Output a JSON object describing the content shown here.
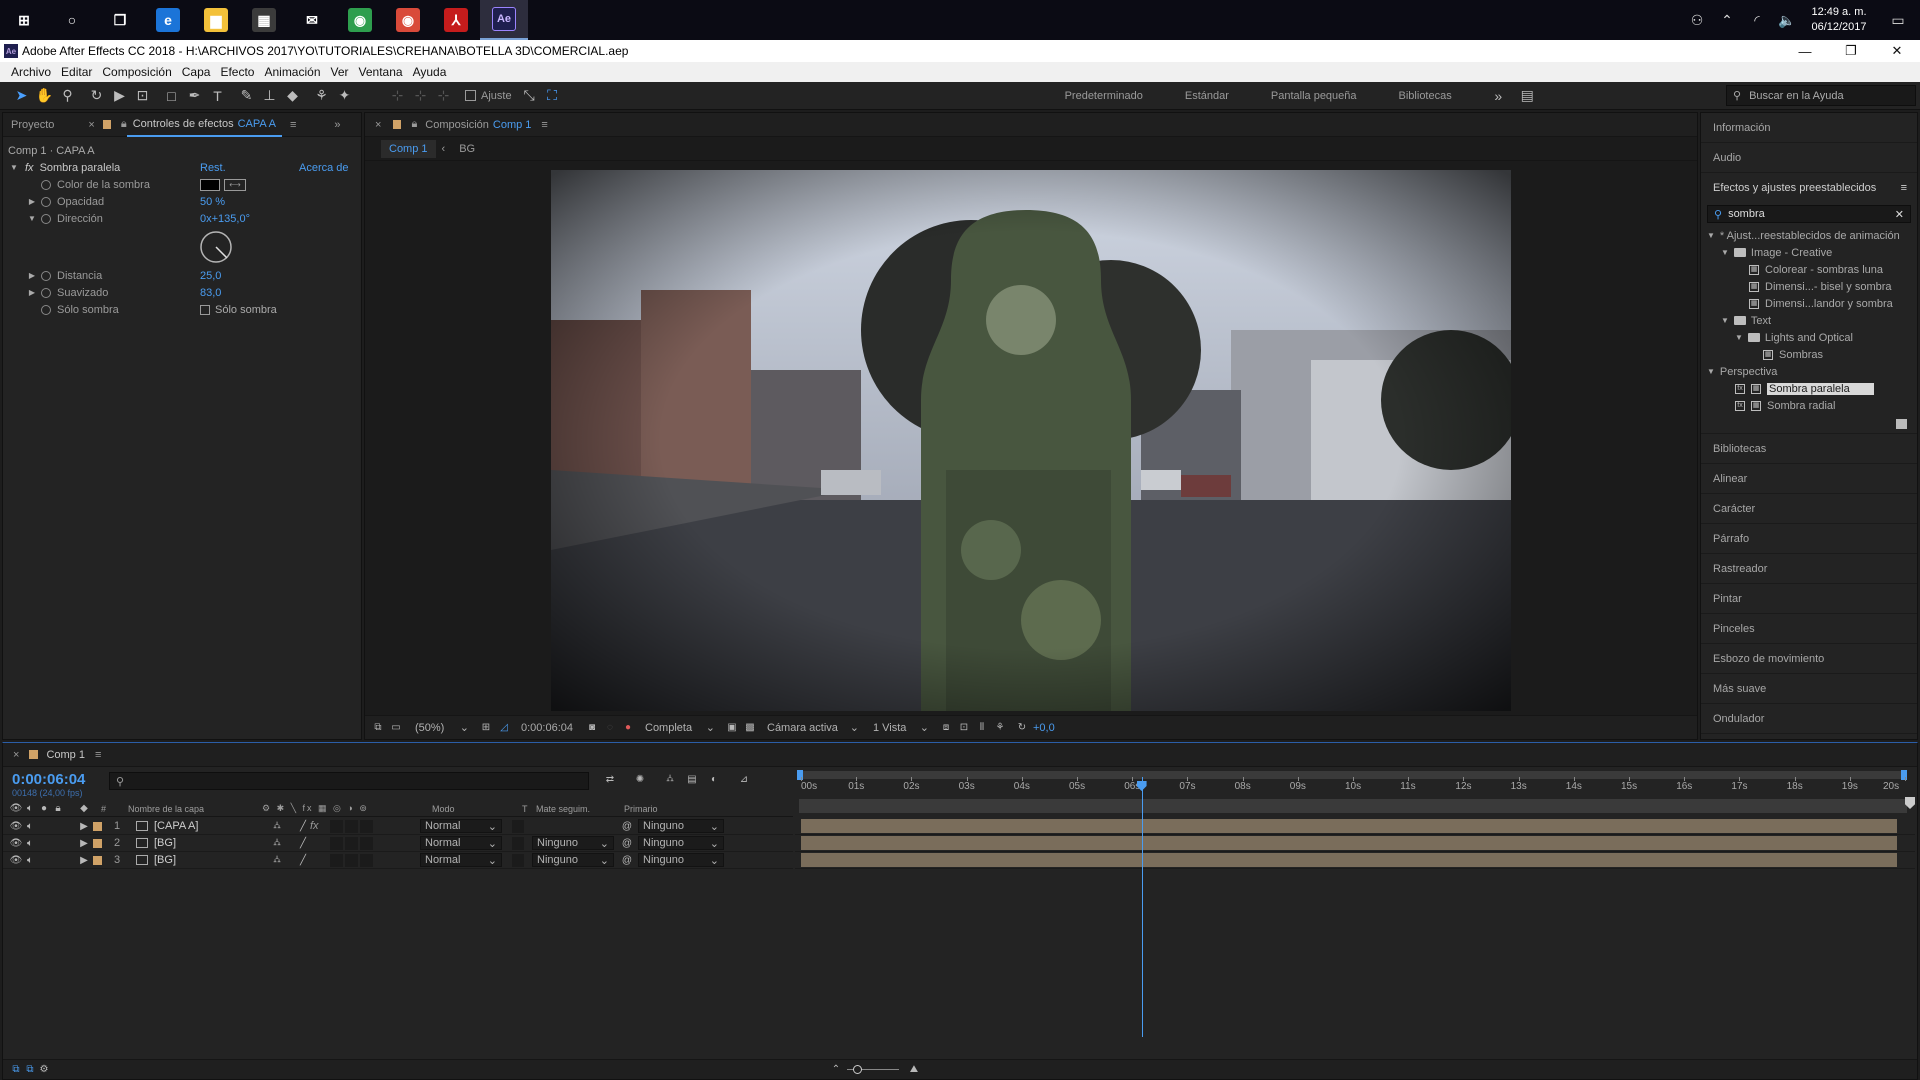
{
  "taskbar": {
    "apps": [
      {
        "name": "start-icon",
        "glyph": "⊞",
        "bg": "transparent"
      },
      {
        "name": "cortana-icon",
        "glyph": "○",
        "bg": "transparent"
      },
      {
        "name": "task-view-icon",
        "glyph": "❐",
        "bg": "transparent"
      },
      {
        "name": "edge-icon",
        "glyph": "e",
        "bg": "#1b74d8"
      },
      {
        "name": "file-explorer-icon",
        "glyph": "▆",
        "bg": "#f3c13a"
      },
      {
        "name": "store-icon",
        "glyph": "▦",
        "bg": "#3b3b3b"
      },
      {
        "name": "mail-icon",
        "glyph": "✉",
        "bg": "transparent"
      },
      {
        "name": "chrome-icon",
        "glyph": "◉",
        "bg": "#2e9e4e"
      },
      {
        "name": "chrome-profile-icon",
        "glyph": "◉",
        "bg": "#d94a3a"
      },
      {
        "name": "acrobat-icon",
        "glyph": "⅄",
        "bg": "#c51c1c"
      },
      {
        "name": "after-effects-icon",
        "glyph": "Ae",
        "bg": "#1f1f4f"
      }
    ],
    "time": "12:49 a. m.",
    "date": "06/12/2017"
  },
  "window": {
    "title": "Adobe After Effects CC 2018 - H:\\ARCHIVOS 2017\\YO\\TUTORIALES\\CREHANA\\BOTELLA 3D\\COMERCIAL.aep"
  },
  "menu": [
    "Archivo",
    "Editar",
    "Composición",
    "Capa",
    "Efecto",
    "Animación",
    "Ver",
    "Ventana",
    "Ayuda"
  ],
  "toolbar": {
    "snap_label": "Ajuste",
    "workspaces": [
      "Predeterminado",
      "Estándar",
      "Pantalla pequeña",
      "Bibliotecas"
    ],
    "help_search": "Buscar en la Ayuda"
  },
  "effects_panel": {
    "project_tab": "Proyecto",
    "tab_label": "Controles de efectos",
    "tab_layer": "CAPA A",
    "header": "Comp 1 · CAPA A",
    "effect_name": "Sombra paralela",
    "reset": "Rest.",
    "about": "Acerca de",
    "props": {
      "color": "Color de la sombra",
      "opacity": "Opacidad",
      "opacity_val": "50 %",
      "direction": "Dirección",
      "direction_val": "0x+135,0°",
      "distance": "Distancia",
      "distance_val": "25,0",
      "softness": "Suavizado",
      "softness_val": "83,0",
      "shadow_only": "Sólo sombra",
      "shadow_only_val": "Sólo sombra"
    }
  },
  "comp_panel": {
    "tab_prefix": "Composición",
    "tab_name": "Comp 1",
    "crumb_comp": "Comp 1",
    "crumb_bg": "BG",
    "footer": {
      "zoom": "(50%)",
      "time": "0:00:06:04",
      "resolution": "Completa",
      "camera": "Cámara activa",
      "views": "1 Vista",
      "exposure": "+0,0"
    }
  },
  "right_panel": {
    "top_items": [
      "Información",
      "Audio"
    ],
    "presets_title": "Efectos y ajustes preestablecidos",
    "search_value": "sombra",
    "tree": [
      {
        "label": "* Ajust...reestablecidos de animación",
        "indent": 0,
        "type": "root"
      },
      {
        "label": "Image - Creative",
        "indent": 1,
        "type": "folder"
      },
      {
        "label": "Colorear - sombras luna",
        "indent": 2,
        "type": "preset"
      },
      {
        "label": "Dimensi...- bisel y sombra",
        "indent": 2,
        "type": "preset"
      },
      {
        "label": "Dimensi...landor y sombra",
        "indent": 2,
        "type": "preset"
      },
      {
        "label": "Text",
        "indent": 1,
        "type": "folder"
      },
      {
        "label": "Lights and Optical",
        "indent": 2,
        "type": "folder"
      },
      {
        "label": "Sombras",
        "indent": 3,
        "type": "preset"
      },
      {
        "label": "Perspectiva",
        "indent": 0,
        "type": "root"
      },
      {
        "label": "Sombra paralela",
        "indent": 1,
        "type": "effect",
        "selected": true
      },
      {
        "label": "Sombra radial",
        "indent": 1,
        "type": "effect"
      }
    ],
    "bottom_items": [
      "Bibliotecas",
      "Alinear",
      "Carácter",
      "Párrafo",
      "Rastreador",
      "Pintar",
      "Pinceles",
      "Esbozo de movimiento",
      "Más suave",
      "Ondulador"
    ]
  },
  "timeline": {
    "tab": "Comp 1",
    "timecode": "0:00:06:04",
    "frames": "00148 (24,00 fps)",
    "headers": {
      "num": "#",
      "name": "Nombre de la capa",
      "mode": "Modo",
      "t": "T",
      "matte": "Mate seguim.",
      "parent": "Primario"
    },
    "ruler": [
      "00s",
      "01s",
      "02s",
      "03s",
      "04s",
      "05s",
      "06s",
      "07s",
      "08s",
      "09s",
      "10s",
      "11s",
      "12s",
      "13s",
      "14s",
      "15s",
      "16s",
      "17s",
      "18s",
      "19s",
      "20s"
    ],
    "layers": [
      {
        "num": "1",
        "name": "[CAPA A]",
        "mode": "Normal",
        "matte": "",
        "parent": "Ninguno",
        "fx": "fx"
      },
      {
        "num": "2",
        "name": "[BG]",
        "mode": "Normal",
        "matte": "Ninguno",
        "parent": "Ninguno",
        "fx": ""
      },
      {
        "num": "3",
        "name": "[BG]",
        "mode": "Normal",
        "matte": "Ninguno",
        "parent": "Ninguno",
        "fx": ""
      }
    ],
    "playhead_seconds": 6.17,
    "duration_seconds": 20
  }
}
